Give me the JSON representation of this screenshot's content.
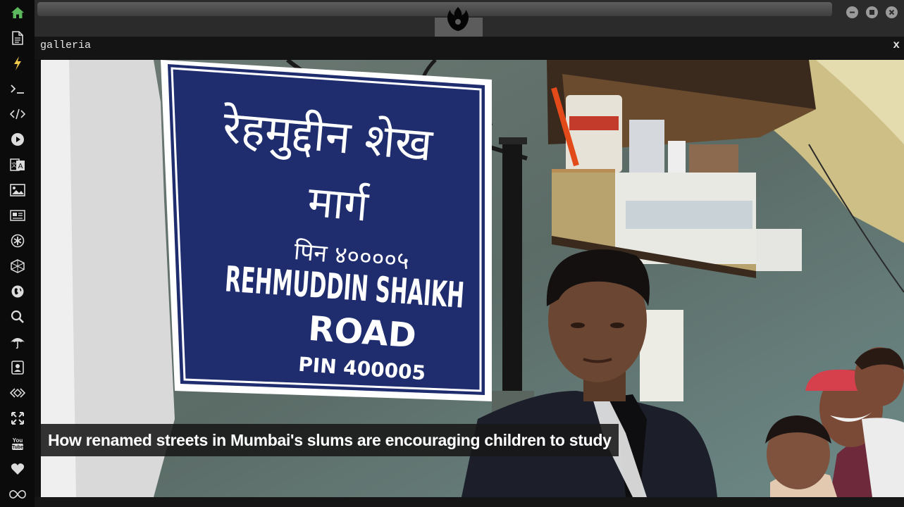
{
  "sidebar": {
    "items": [
      {
        "icon": "home-icon",
        "color": "#5cb85c"
      },
      {
        "icon": "file-icon"
      },
      {
        "icon": "lightning-icon",
        "color": "#f0c84a"
      },
      {
        "icon": "terminal-icon",
        "label": ">_"
      },
      {
        "icon": "code-icon",
        "label": "</>"
      },
      {
        "icon": "play-icon"
      },
      {
        "icon": "translate-icon"
      },
      {
        "icon": "image-icon"
      },
      {
        "icon": "newspaper-icon"
      },
      {
        "icon": "asterisk-icon"
      },
      {
        "icon": "cube-icon"
      },
      {
        "icon": "globe-icon"
      },
      {
        "icon": "search-icon"
      },
      {
        "icon": "umbrella-icon"
      },
      {
        "icon": "contact-card-icon"
      },
      {
        "icon": "api-icon"
      },
      {
        "icon": "expand-icon"
      },
      {
        "icon": "youtube-icon",
        "label": "You Tube"
      },
      {
        "icon": "heart-icon"
      },
      {
        "icon": "infinity-icon"
      }
    ]
  },
  "window": {
    "logo": "rebel-alliance-logo-icon",
    "controls": [
      "minimize",
      "maximize",
      "close"
    ]
  },
  "panel": {
    "title": "galleria",
    "close_label": "x"
  },
  "gallery": {
    "caption": "How renamed streets in Mumbai's slums are encouraging children to study",
    "sign_devanagari_line1": "रेहमुद्दीन शेख",
    "sign_devanagari_line2": "मार्ग",
    "sign_devanagari_line3": "पिन ४००००५",
    "sign_english_line1": "REHMUDDIN SHAIKH",
    "sign_english_line2": "ROAD",
    "sign_english_line3": "PIN 400005"
  }
}
